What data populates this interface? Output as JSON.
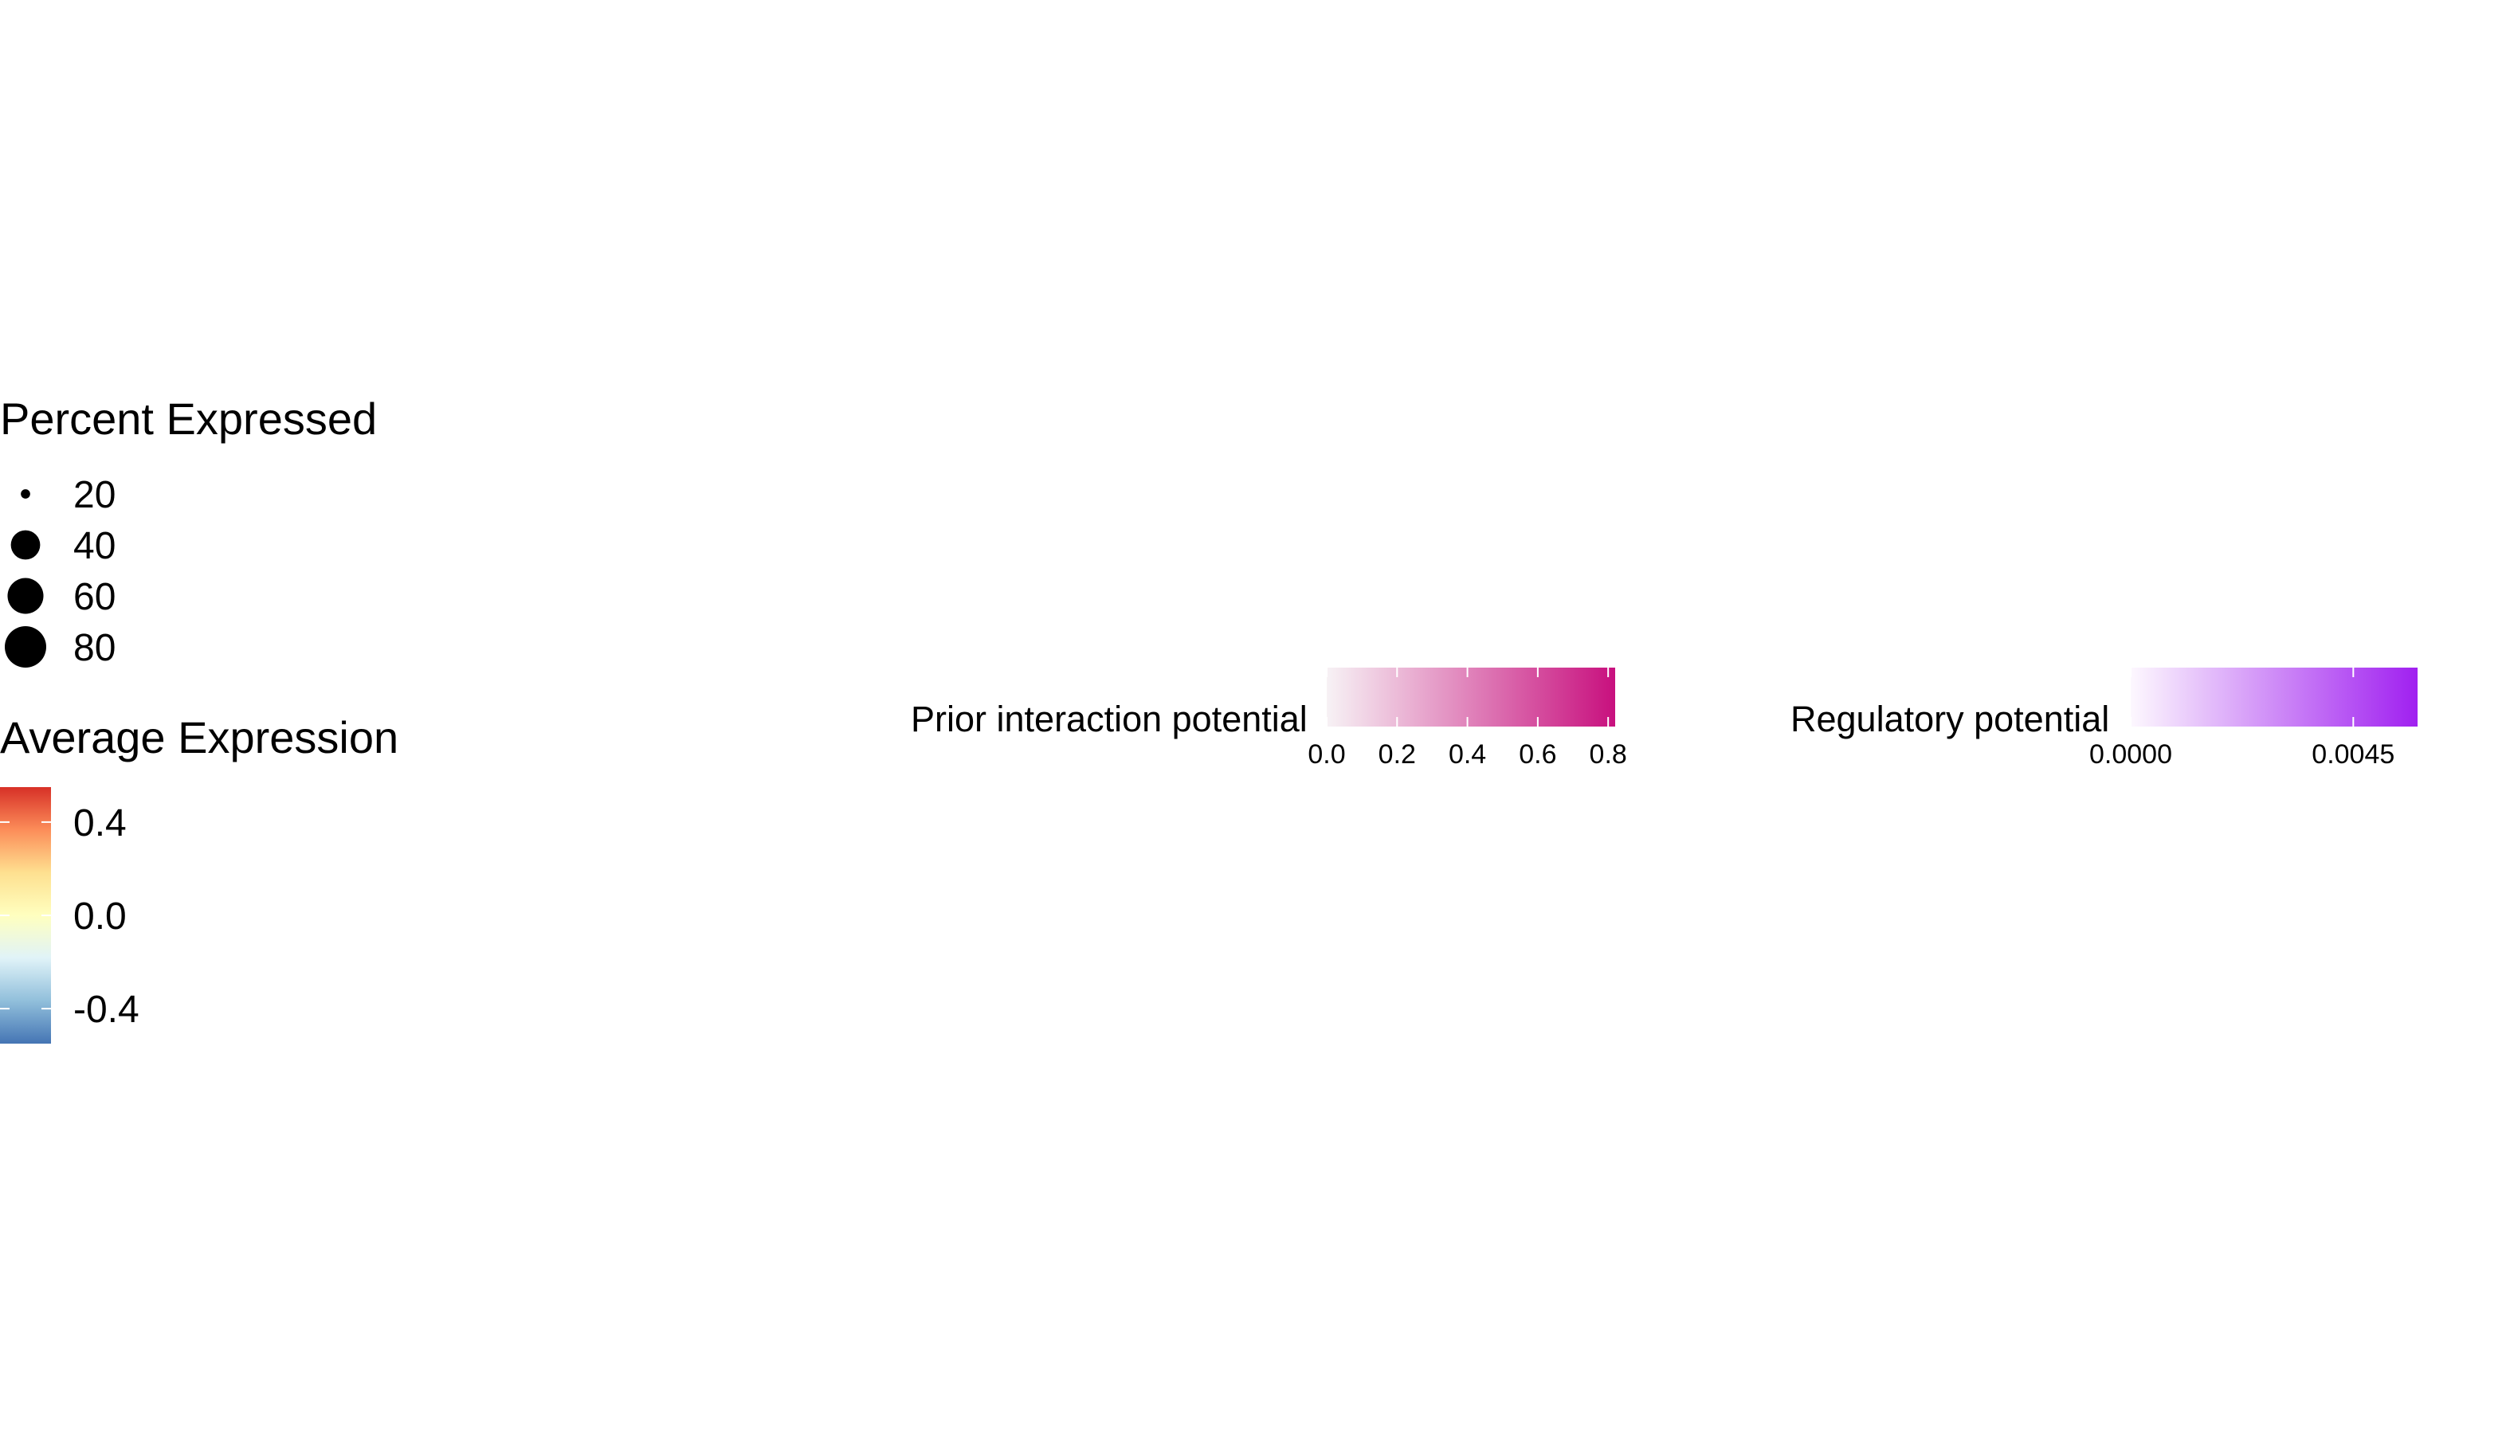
{
  "chart_data": [
    {
      "type": "legend",
      "kind": "size",
      "title": "Percent Expressed",
      "values": [
        20,
        40,
        60,
        80
      ],
      "labels": [
        "20",
        "40",
        "60",
        "80"
      ],
      "marker_color": "#000000"
    },
    {
      "type": "legend",
      "kind": "colorbar",
      "orientation": "vertical",
      "title": "Average Expression",
      "range": [
        -0.55,
        0.55
      ],
      "ticks": [
        0.4,
        0.0,
        -0.4
      ],
      "tick_labels": [
        "0.4",
        "0.0",
        "-0.4"
      ],
      "colors_low_to_high": [
        "#4575B4",
        "#91BFDB",
        "#E0F3F8",
        "#FFFFBF",
        "#FEE090",
        "#FC8D59",
        "#D73027"
      ]
    },
    {
      "type": "legend",
      "kind": "colorbar",
      "orientation": "horizontal",
      "title": "Prior interaction potential",
      "range": [
        0.0,
        0.82
      ],
      "ticks": [
        0.0,
        0.2,
        0.4,
        0.6,
        0.8
      ],
      "tick_labels": [
        "0.0",
        "0.2",
        "0.4",
        "0.6",
        "0.8"
      ],
      "colors_low_to_high": [
        "#F7F2F5",
        "#C8107E"
      ]
    },
    {
      "type": "legend",
      "kind": "colorbar",
      "orientation": "horizontal",
      "title": "Regulatory potential",
      "range": [
        0.0,
        0.0058
      ],
      "ticks": [
        0.0,
        0.0045
      ],
      "tick_labels": [
        "0.0000",
        "0.0045"
      ],
      "colors_low_to_high": [
        "#FDF8FE",
        "#A020F0"
      ]
    }
  ]
}
